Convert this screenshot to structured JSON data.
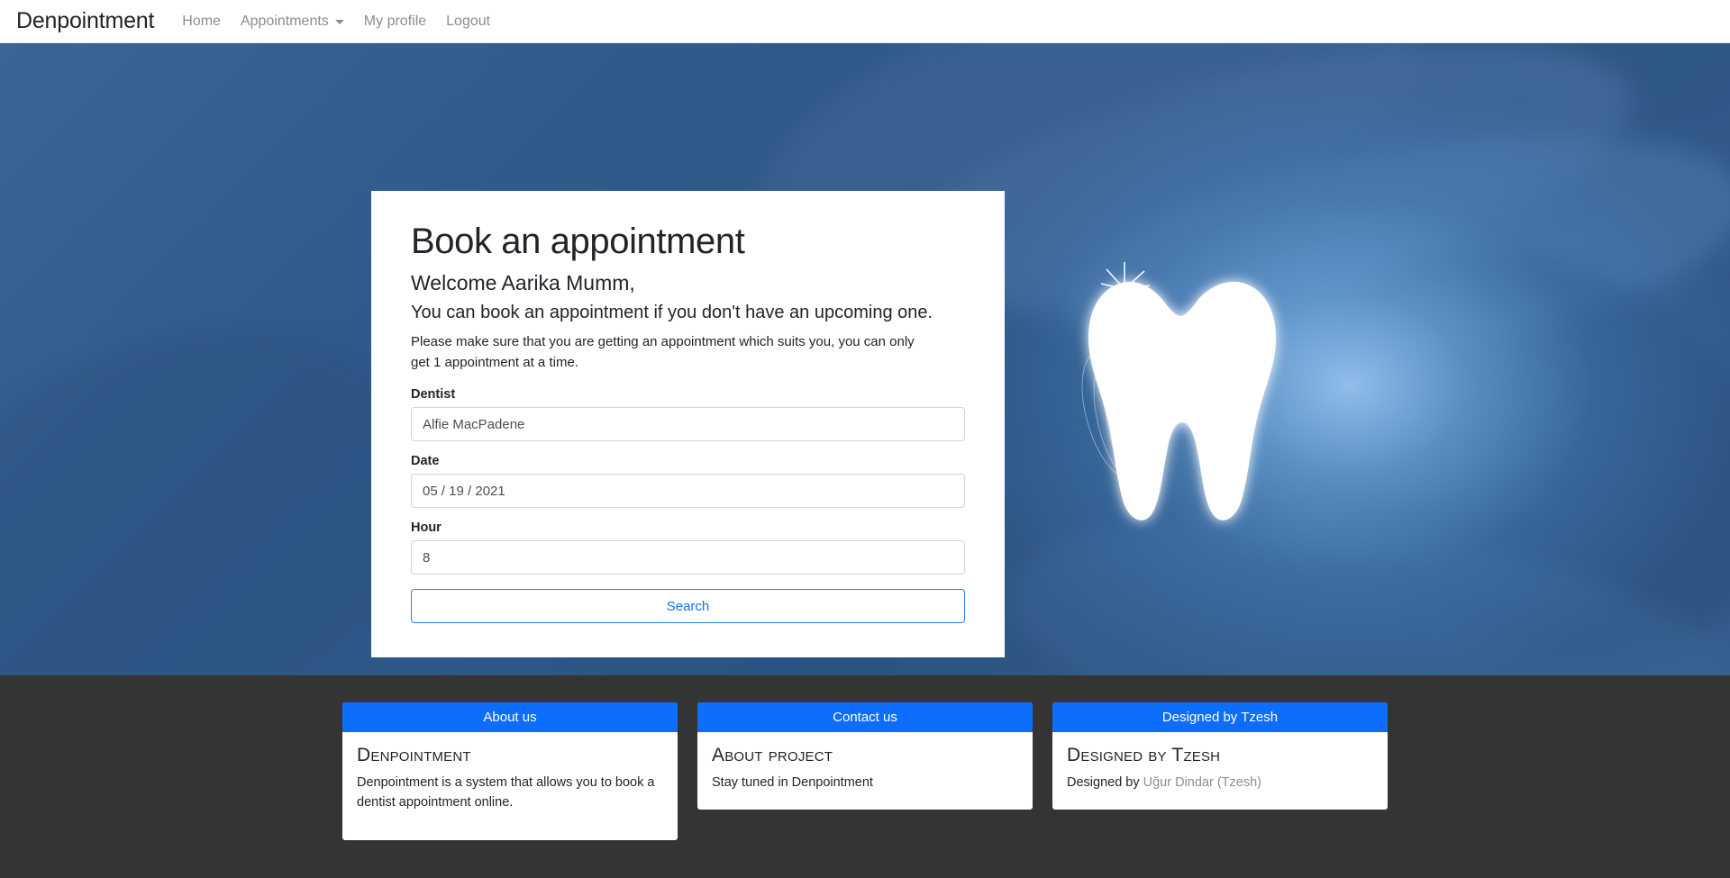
{
  "navbar": {
    "brand": "Denpointment",
    "links": [
      {
        "label": "Home",
        "caret": false
      },
      {
        "label": "Appointments",
        "caret": true
      },
      {
        "label": "My profile",
        "caret": false
      },
      {
        "label": "Logout",
        "caret": false
      }
    ]
  },
  "hero": {
    "background_color": "#2f5b8c",
    "image_subject": "tooth-illustration"
  },
  "card": {
    "title": "Book an appointment",
    "welcome": "Welcome Aarika Mumm,",
    "subtitle": "You can book an appointment if you don't have an upcoming one.",
    "note": "Please make sure that you are getting an appointment which suits you, you can only get 1 appointment at a time.",
    "fields": {
      "dentist": {
        "label": "Dentist",
        "value": "Alfie MacPadene",
        "placeholder": "Dentist"
      },
      "date": {
        "label": "Date",
        "value": "05 / 19 / 2021",
        "placeholder": "mm / dd / yyyy"
      },
      "hour": {
        "label": "Hour",
        "value": "8",
        "placeholder": "Hour"
      }
    },
    "search_button": "Search"
  },
  "footer": {
    "background_color": "#343434",
    "accent_color": "#0d6efd",
    "cards": [
      {
        "header": "About us",
        "title": "Denpointment",
        "text": "Denpointment is a system that allows you to book a dentist appointment online.",
        "link_text": ""
      },
      {
        "header": "Contact us",
        "title": "About project",
        "text": "Stay tuned in Denpointment",
        "link_text": ""
      },
      {
        "header": "Designed by Tzesh",
        "title": "Designed by Tzesh",
        "text": "Designed by ",
        "link_text": "Uğur Dindar (Tzesh)"
      }
    ]
  }
}
